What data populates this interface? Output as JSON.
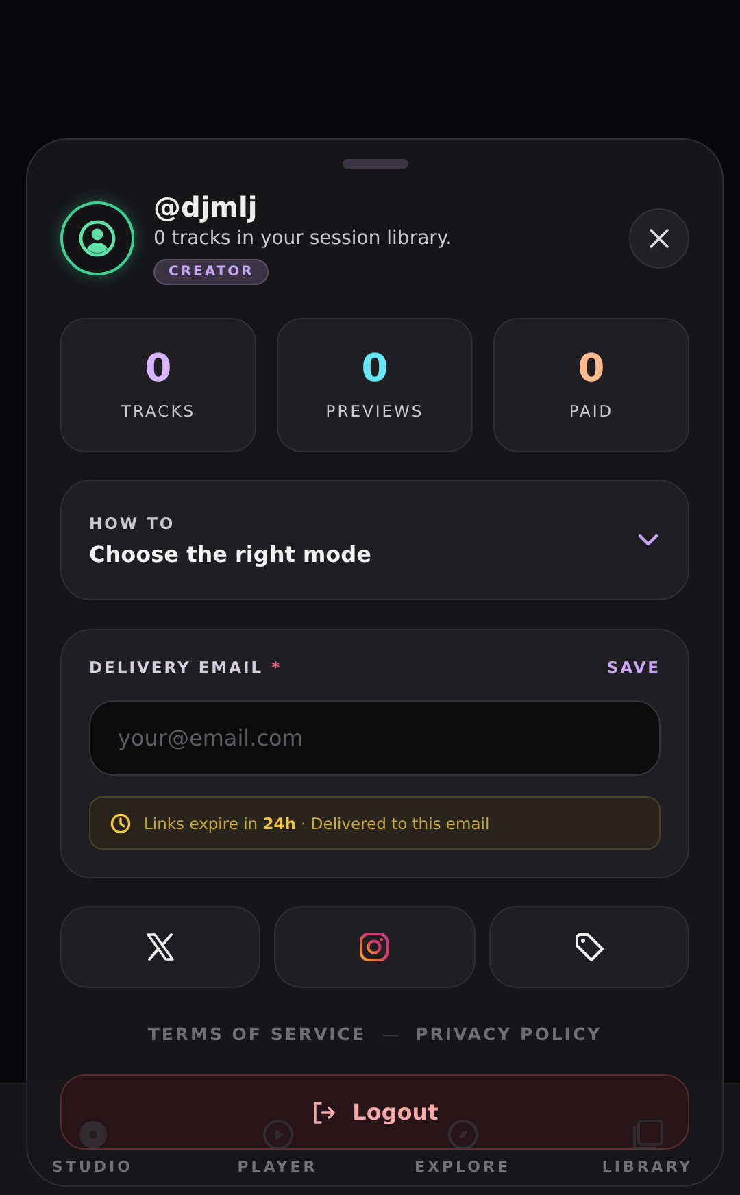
{
  "bottom_nav": [
    {
      "label": "STUDIO"
    },
    {
      "label": "PLAYER"
    },
    {
      "label": "EXPLORE"
    },
    {
      "label": "LIBRARY"
    }
  ],
  "profile": {
    "username": "@djmlj",
    "subtitle": "0 tracks in your session library.",
    "badge": "CREATOR"
  },
  "stats": [
    {
      "value": "0",
      "label": "TRACKS",
      "color": "#d8b4fe"
    },
    {
      "value": "0",
      "label": "PREVIEWS",
      "color": "#67e8f9"
    },
    {
      "value": "0",
      "label": "PAID",
      "color": "#fdba8c"
    }
  ],
  "how_to": {
    "eyebrow": "HOW TO",
    "title": "Choose the right mode",
    "expanded": false
  },
  "delivery_email": {
    "label": "DELIVERY EMAIL",
    "required_mark": "*",
    "save": "SAVE",
    "placeholder": "your@email.com",
    "notice": "Links expire in **24h** · Delivered to this email"
  },
  "social": [
    {
      "kind": "x"
    },
    {
      "kind": "instagram"
    },
    {
      "kind": "tag"
    }
  ],
  "links": [
    "TERMS OF SERVICE",
    "PRIVACY POLICY"
  ],
  "separator": "—",
  "logout": "Logout"
}
